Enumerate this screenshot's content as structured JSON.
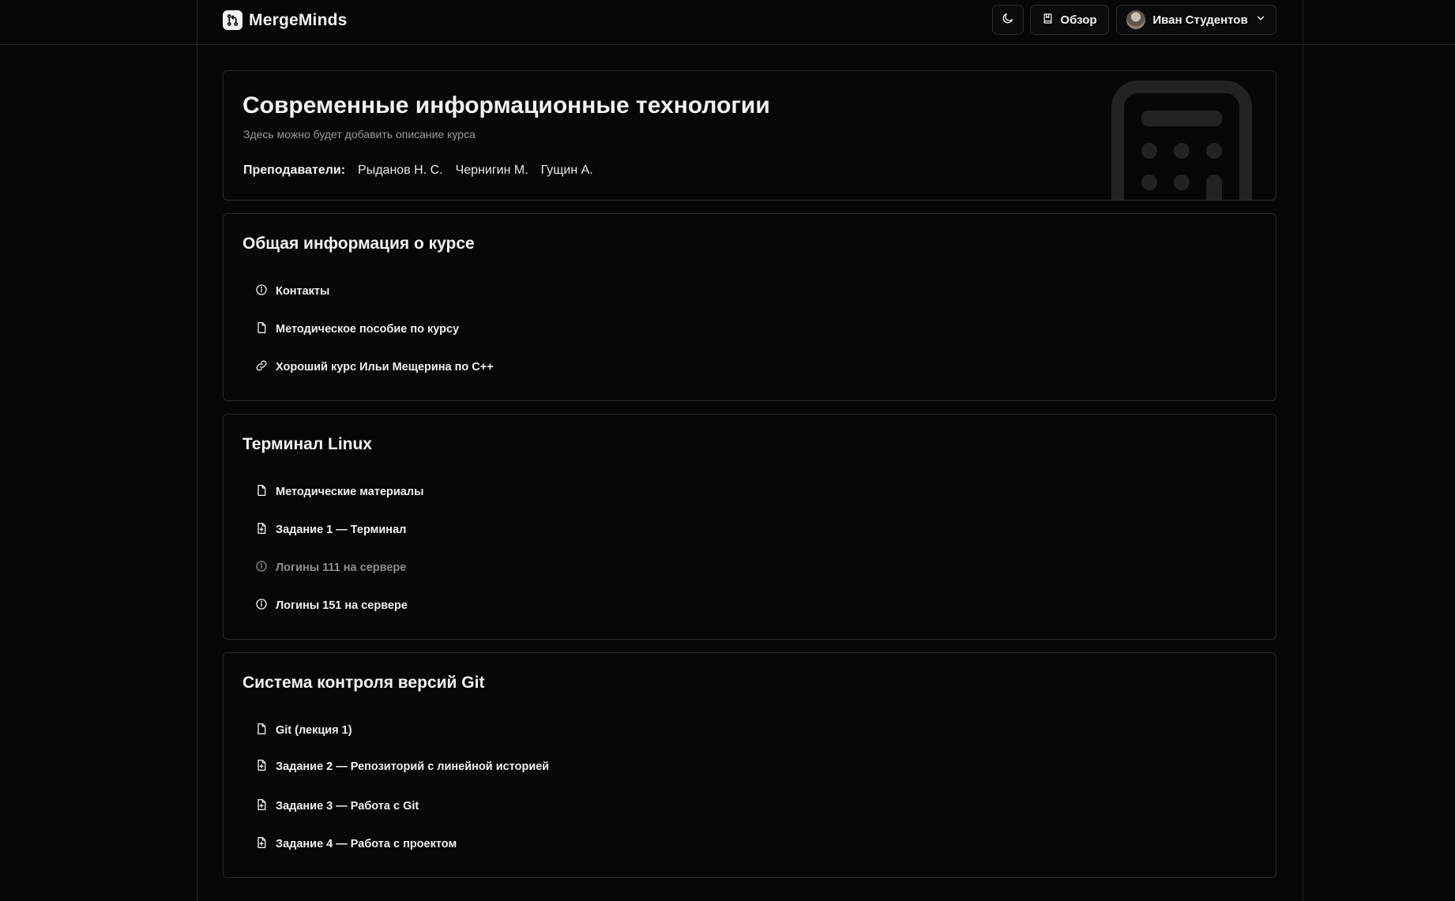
{
  "app": {
    "name": "MergeMinds"
  },
  "header": {
    "theme_icon": "moon-icon",
    "overview_label": "Обзор",
    "overview_icon": "book-icon",
    "user_name": "Иван Студентов",
    "user_menu_icon": "chevron-down-icon"
  },
  "course": {
    "title": "Современные информационные технологии",
    "description": "Здесь можно будет добавить описание курса",
    "teachers_label": "Преподаватели:",
    "teachers": [
      "Рыданов Н. С.",
      "Чернигин М.",
      "Гущин А."
    ],
    "decor_icon": "calculator-icon"
  },
  "sections": [
    {
      "title": "Общая информация о курсе",
      "items": [
        {
          "label": "Контакты",
          "icon": "info-icon"
        },
        {
          "label": "Методическое пособие по курсу",
          "icon": "file-icon"
        },
        {
          "label": "Хороший курс Ильи Мещерина по C++",
          "icon": "link-icon"
        }
      ]
    },
    {
      "title": "Терминал Linux",
      "items": [
        {
          "label": "Методические материалы",
          "icon": "file-icon"
        },
        {
          "label": "Задание 1 — Терминал",
          "icon": "file-plus-icon"
        },
        {
          "label": "Логины 111 на сервере",
          "icon": "info-icon",
          "dimmed": true
        },
        {
          "label": "Логины 151 на сервере",
          "icon": "info-icon"
        }
      ]
    },
    {
      "title": "Система контроля версий Git",
      "items": [
        {
          "label": "Git (лекция 1)",
          "icon": "file-icon"
        },
        {
          "label": "Задание 2 — Репозиторий с линейной историей",
          "icon": "file-plus-icon"
        },
        {
          "label": "Задание 3 — Работа с Git",
          "icon": "file-plus-icon"
        },
        {
          "label": "Задание 4 — Работа с проектом",
          "icon": "file-plus-icon"
        }
      ]
    }
  ],
  "colors": {
    "background": "#070709",
    "border": "#2b2b2f",
    "text": "#f2f2f2",
    "muted": "#9a9a9f",
    "dimmed_item": "#8d8d92"
  }
}
